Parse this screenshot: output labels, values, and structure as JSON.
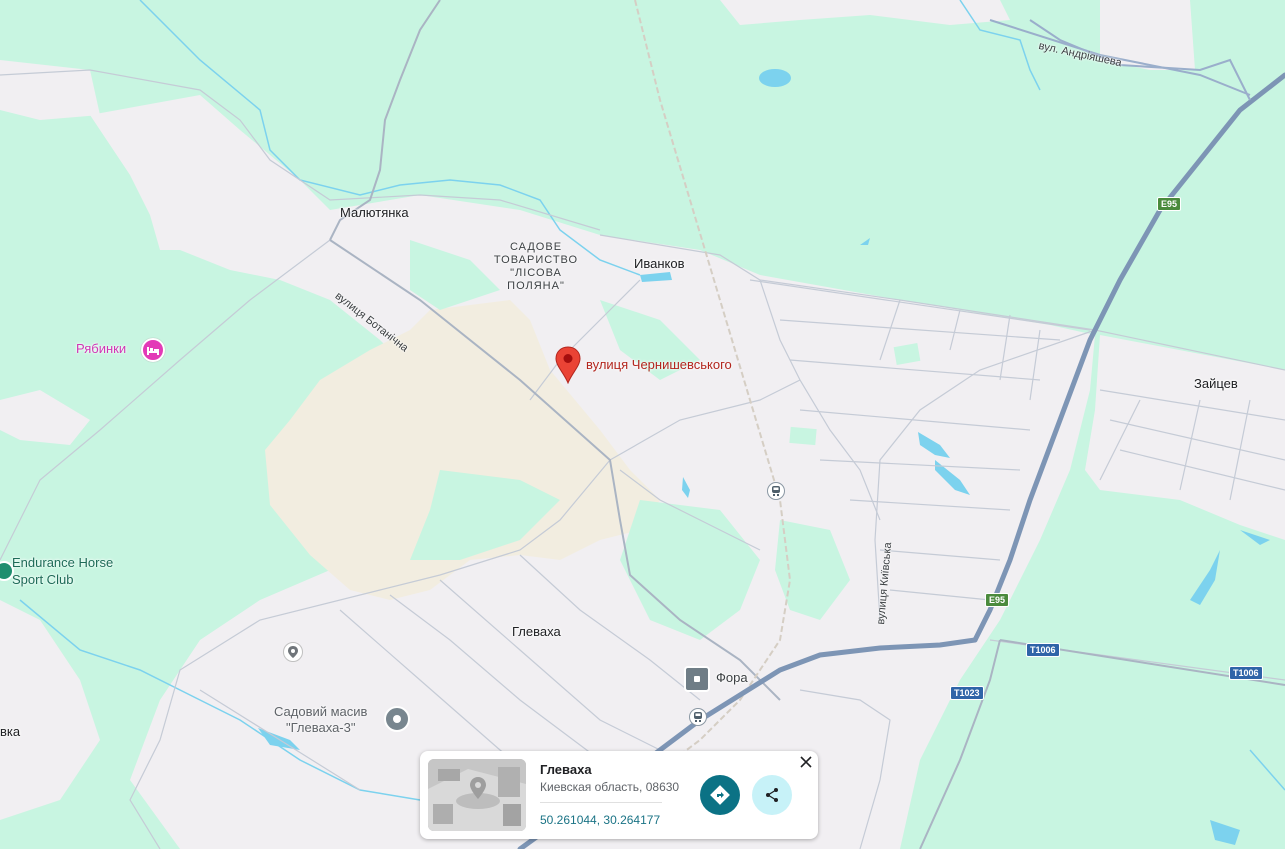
{
  "map": {
    "colors": {
      "forest": "#c8f5e1",
      "urban": "#f1eff2",
      "sand": "#f2ede0",
      "water": "#7cd2ee",
      "road": "#ffffff",
      "road_outline": "#c5cbd6",
      "highway": "#7d95b5",
      "rail": "#d7d2c8"
    },
    "places": {
      "malyutianka": "Малютянка",
      "ivankov": "Иванков",
      "zaitsev": "Зайцев",
      "hlevakha": "Глеваха",
      "vka": "вка"
    },
    "garden_coop": "САДОВЕ\nТОВАРИСТВО\n\"ЛІСОВА\nПОЛЯНА\"",
    "streets": {
      "botanichna": "вулиця Ботанічна",
      "andriiasheva": "вул. Андріяшева",
      "kyivska": "вулиця Київська"
    },
    "pois": {
      "riabynky": "Рябинки",
      "endurance": "Endurance Horse\nSport Club",
      "sadovyi_masyv": "Садовий масив\n\"Глеваха-3\"",
      "fora": "Фора"
    },
    "pin": {
      "label": "вулиця Чернишевського",
      "color": "#ea4335"
    },
    "shields": {
      "e95_top": "E95",
      "e95_bottom": "E95",
      "t1006_a": "T1006",
      "t1006_b": "T1006",
      "t1023": "T1023"
    }
  },
  "card": {
    "title": "Глеваха",
    "address": "Киевская область, 08630",
    "coordinates": "50.261044, 30.264177",
    "icons": {
      "directions": "directions-icon",
      "share": "share-icon",
      "close": "close-icon"
    }
  }
}
